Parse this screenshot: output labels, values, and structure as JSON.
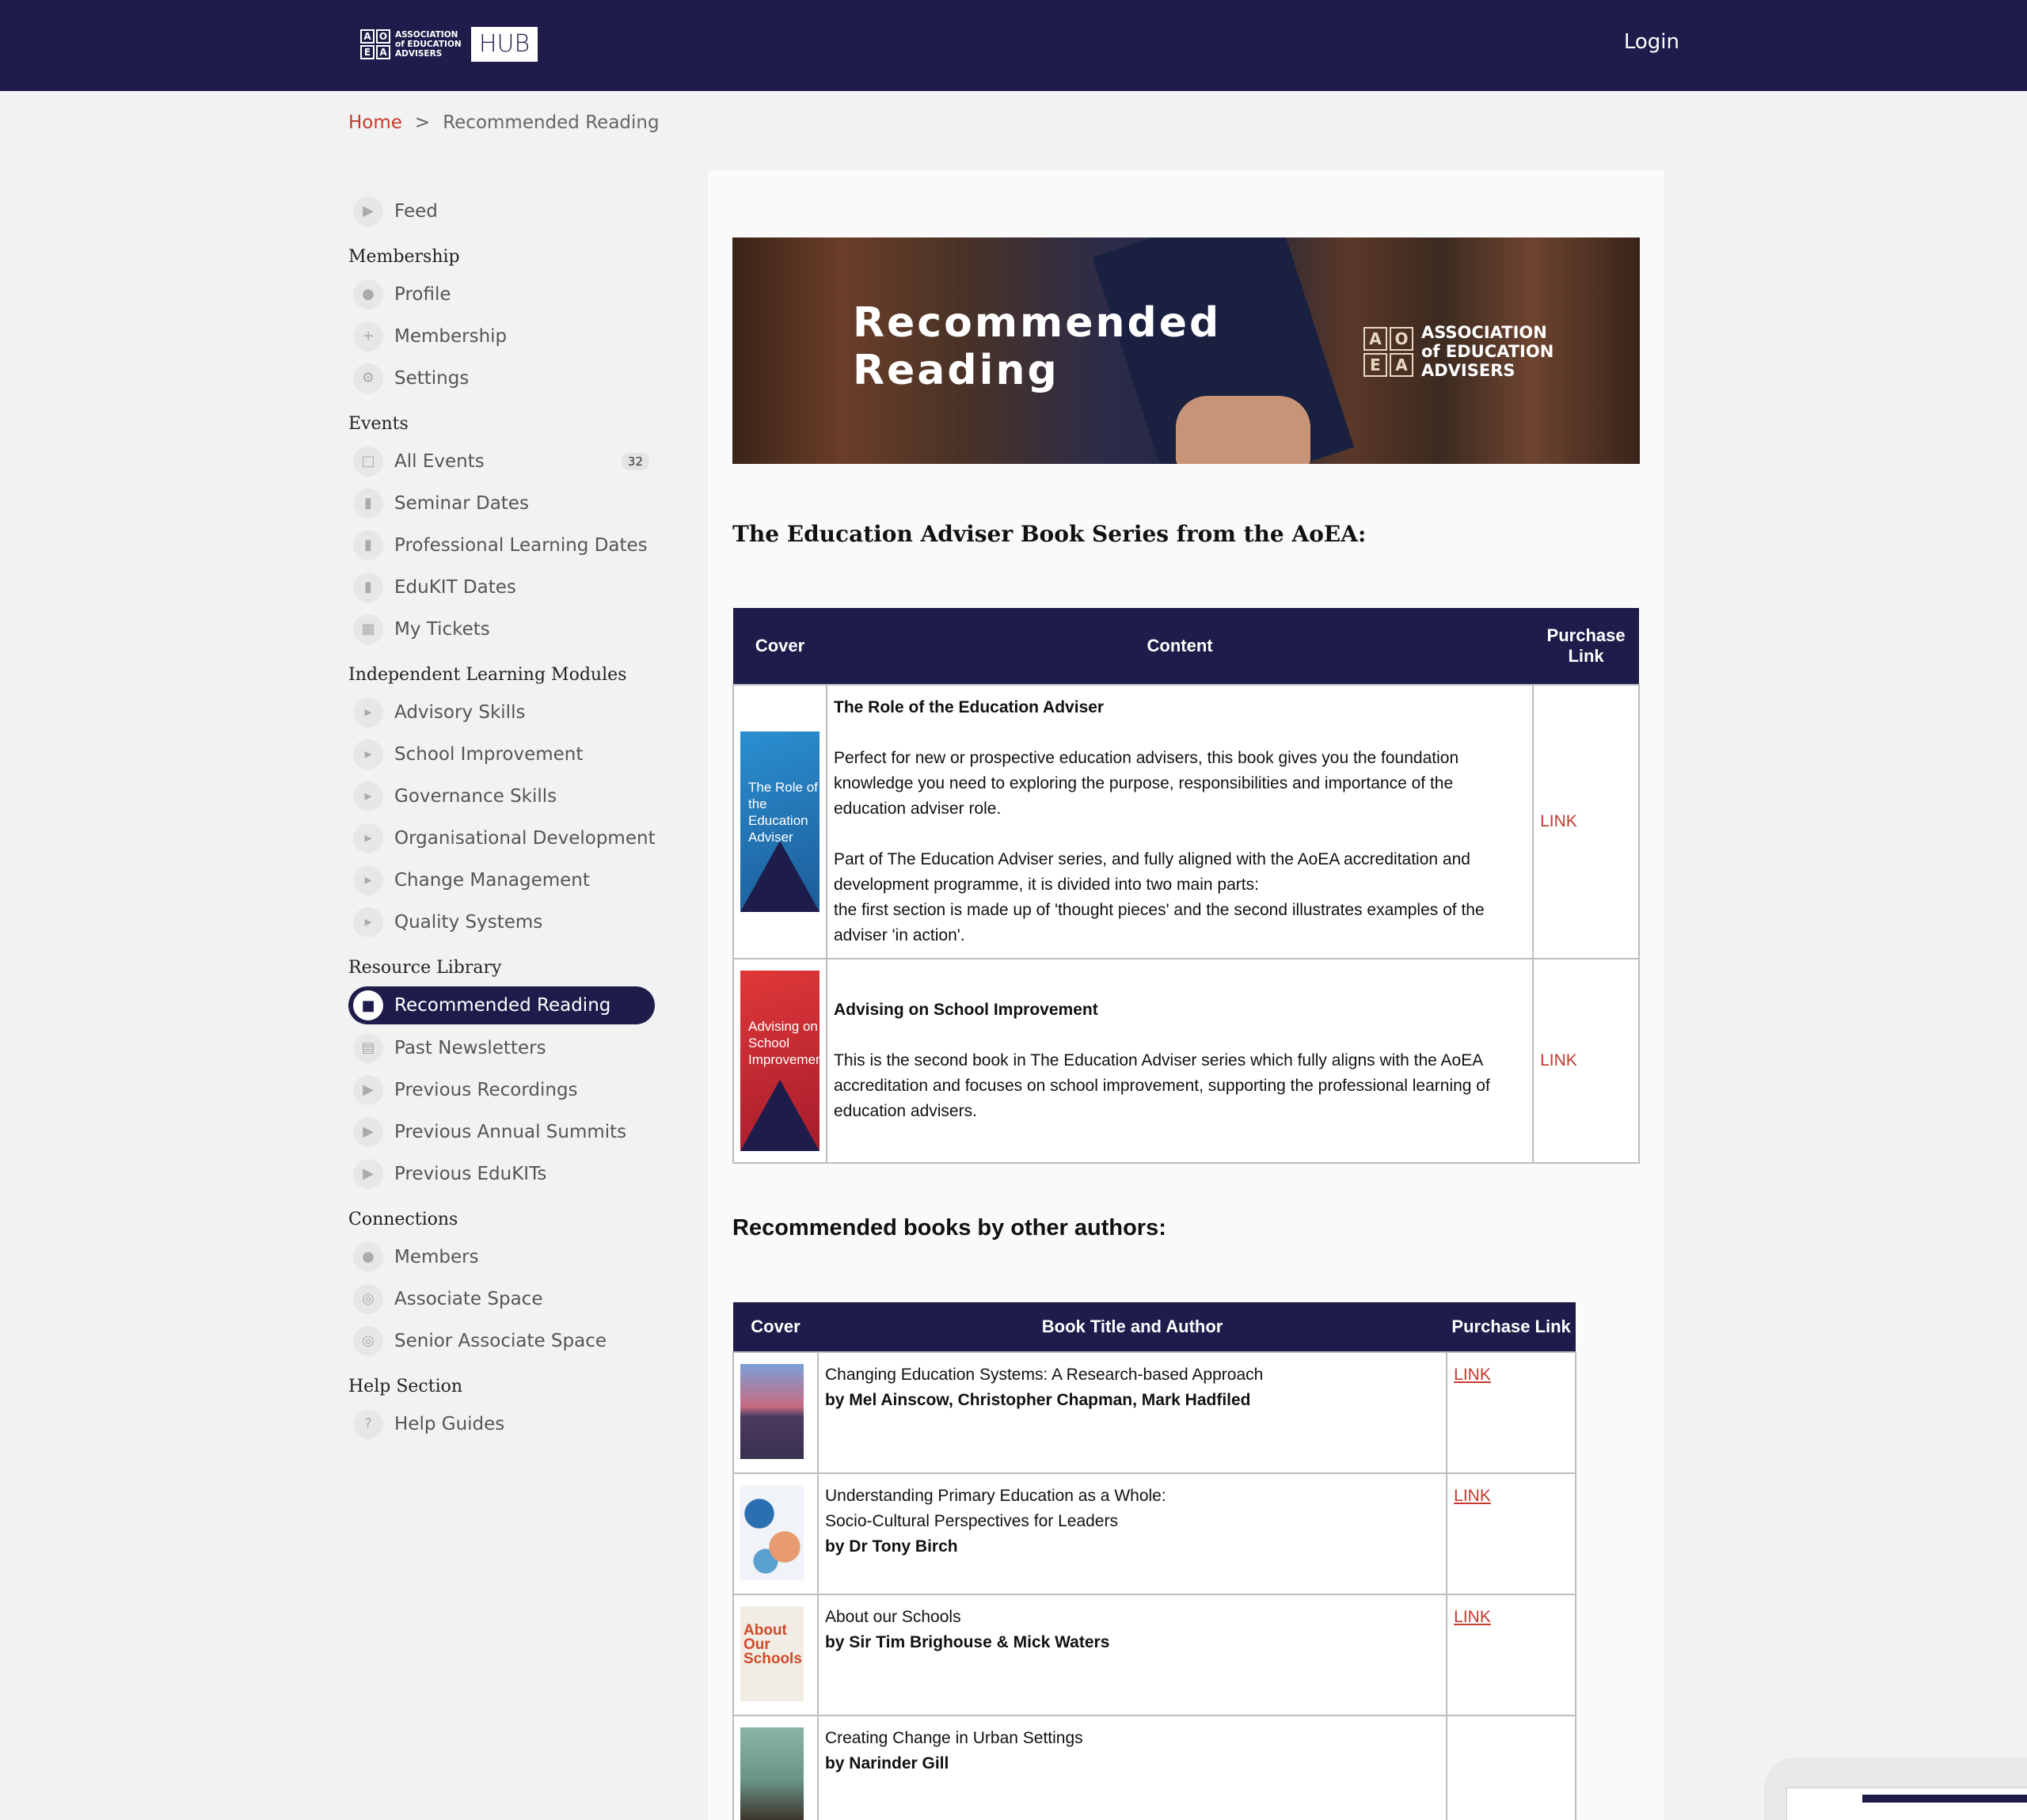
{
  "header": {
    "logo_cells": [
      "A",
      "O",
      "E",
      "A"
    ],
    "logo_text": "ASSOCIATION of EDUCATION ADVISERS",
    "logo_hub": "HUB",
    "login": "Login"
  },
  "breadcrumb": {
    "home": "Home",
    "separator": ">",
    "current": "Recommended Reading"
  },
  "sidebar": {
    "feed": {
      "label": "Feed",
      "icon": "megaphone-icon"
    },
    "membership": {
      "heading": "Membership",
      "items": [
        {
          "label": "Profile",
          "icon": "user-icon"
        },
        {
          "label": "Membership",
          "icon": "plus-icon"
        },
        {
          "label": "Settings",
          "icon": "gear-icon"
        }
      ]
    },
    "events": {
      "heading": "Events",
      "items": [
        {
          "label": "All Events",
          "icon": "calendar-icon",
          "badge": "32"
        },
        {
          "label": "Seminar Dates",
          "icon": "bookmark-icon"
        },
        {
          "label": "Professional Learning Dates",
          "icon": "bookmark-icon"
        },
        {
          "label": "EduKIT Dates",
          "icon": "bookmark-icon"
        },
        {
          "label": "My Tickets",
          "icon": "qr-icon"
        }
      ]
    },
    "modules": {
      "heading": "Independent Learning Modules",
      "items": [
        {
          "label": "Advisory Skills",
          "icon": "caret-right-icon"
        },
        {
          "label": "School Improvement",
          "icon": "caret-right-icon"
        },
        {
          "label": "Governance Skills",
          "icon": "caret-right-icon"
        },
        {
          "label": "Organisational Development",
          "icon": "caret-right-icon"
        },
        {
          "label": "Change Management",
          "icon": "caret-right-icon"
        },
        {
          "label": "Quality Systems",
          "icon": "caret-right-icon"
        }
      ]
    },
    "resources": {
      "heading": "Resource Library",
      "items": [
        {
          "label": "Recommended Reading",
          "icon": "book-icon",
          "active": true
        },
        {
          "label": "Past Newsletters",
          "icon": "document-icon"
        },
        {
          "label": "Previous Recordings",
          "icon": "play-icon"
        },
        {
          "label": "Previous Annual Summits",
          "icon": "play-icon"
        },
        {
          "label": "Previous EduKITs",
          "icon": "play-icon"
        }
      ]
    },
    "connections": {
      "heading": "Connections",
      "items": [
        {
          "label": "Members",
          "icon": "users-icon"
        },
        {
          "label": "Associate Space",
          "icon": "target-icon"
        },
        {
          "label": "Senior Associate Space",
          "icon": "target-icon"
        }
      ]
    },
    "help": {
      "heading": "Help Section",
      "items": [
        {
          "label": "Help Guides",
          "icon": "question-icon"
        }
      ]
    }
  },
  "banner": {
    "title_line1": "Recommended",
    "title_line2": "Reading",
    "logo_cells": [
      "A",
      "O",
      "E",
      "A"
    ],
    "logo_text": "ASSOCIATION of EDUCATION ADVISERS"
  },
  "series": {
    "heading": "The Education Adviser Book Series from the AoEA:",
    "columns": {
      "cover": "Cover",
      "content": "Content",
      "purchase": "Purchase Link"
    },
    "rows": [
      {
        "cover_text": "The Role of the Education Adviser",
        "title": "The Role of the Education Adviser",
        "para1": "Perfect for new or prospective education advisers, this book gives you the foundation knowledge you need to exploring the purpose, responsibilities and importance of the education adviser role.",
        "para2": "Part of The Education Adviser series, and fully aligned with the AoEA accreditation and development programme, it is divided into two main parts:",
        "para3": "the first section is made up of 'thought pieces' and the second illustrates examples of the adviser 'in action'.",
        "link": "LINK"
      },
      {
        "cover_text": "Advising on School Improvement",
        "title": "Advising on School Improvement",
        "para1": "This is the second book in The Education Adviser series which fully aligns with the AoEA accreditation and focuses on school improvement, supporting the professional learning of education advisers.",
        "link": "LINK"
      }
    ]
  },
  "others": {
    "heading": "Recommended books by other authors:",
    "columns": {
      "cover": "Cover",
      "title": "Book Title and Author",
      "purchase": "Purchase Link"
    },
    "rows": [
      {
        "title": "Changing Education Systems: A Research-based Approach",
        "title2": "",
        "author": "by Mel Ainscow, Christopher Chapman, Mark Hadfiled",
        "link": "LINK"
      },
      {
        "title": "Understanding Primary Education as a Whole:",
        "title2": "Socio-Cultural Perspectives for Leaders",
        "author": "by Dr Tony Birch",
        "link": "LINK"
      },
      {
        "title": "About our Schools",
        "title2": "",
        "author": "by Sir Tim Brighouse & Mick Waters",
        "link": "LINK",
        "cover_text": "About Our Schools"
      },
      {
        "title": "Creating Change in Urban Settings",
        "title2": "",
        "author": "by Narinder Gill",
        "link": ""
      }
    ]
  }
}
